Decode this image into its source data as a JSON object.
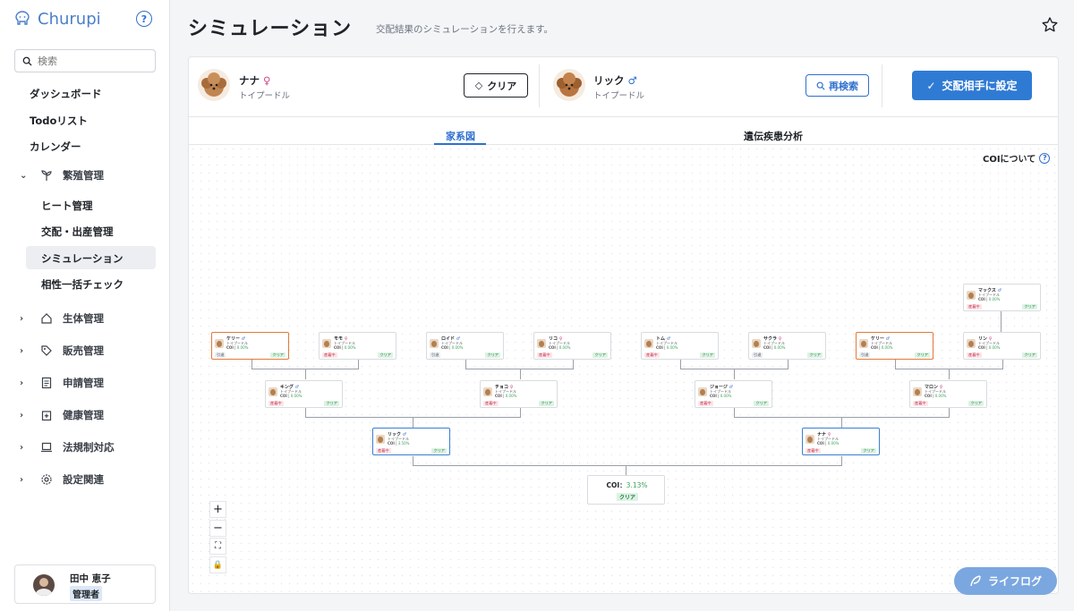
{
  "app": {
    "name": "Churupi",
    "help": "?"
  },
  "search": {
    "placeholder": "検索"
  },
  "nav": {
    "items": [
      "ダッシュボード",
      "Todoリスト",
      "カレンダー"
    ],
    "breeding": {
      "label": "繁殖管理",
      "sub": [
        "ヒート管理",
        "交配・出産管理",
        "シミュレーション",
        "相性一括チェック"
      ],
      "active_index": 2
    },
    "groups": [
      {
        "label": "生体管理",
        "icon": "house-icon"
      },
      {
        "label": "販売管理",
        "icon": "tag-icon"
      },
      {
        "label": "申請管理",
        "icon": "document-icon"
      },
      {
        "label": "健康管理",
        "icon": "medical-icon"
      },
      {
        "label": "法規制対応",
        "icon": "laptop-icon"
      },
      {
        "label": "設定関連",
        "icon": "gear-icon"
      }
    ]
  },
  "user": {
    "name": "田中 恵子",
    "role": "管理者"
  },
  "header": {
    "title": "シミュレーション",
    "subtitle": "交配結果のシミュレーションを行えます。"
  },
  "female": {
    "name": "ナナ",
    "sex_symbol": "♀",
    "breed": "トイプードル"
  },
  "male": {
    "name": "リック",
    "sex_symbol": "♂",
    "breed": "トイプードル"
  },
  "buttons": {
    "clear": "クリア",
    "research": "再検索",
    "set_partner": "交配相手に設定"
  },
  "tabs": {
    "pedigree": "家系図",
    "disease": "遺伝疾患分析"
  },
  "coi_about": "COIについて",
  "tree": {
    "coi_label": "COI",
    "clear_label": "クリア",
    "result": {
      "label": "COI：",
      "value": "3.13%",
      "badge": "クリア"
    },
    "nodes": [
      {
        "id": "max",
        "name": "マックス",
        "sex": "♂",
        "breed": "トイプードル",
        "coi": "0.00%",
        "status": "産着中",
        "status_type": "red"
      },
      {
        "id": "kerry1",
        "name": "ケリー",
        "sex": "♂",
        "breed": "トイプードル",
        "coi": "0.00%",
        "status": "引退",
        "status_type": "gray",
        "highlight": "orange"
      },
      {
        "id": "momo",
        "name": "モモ",
        "sex": "♀",
        "breed": "トイプードル",
        "coi": "0.00%",
        "status": "産着中",
        "status_type": "red"
      },
      {
        "id": "lloyd",
        "name": "ロイド",
        "sex": "♂",
        "breed": "トイプードル",
        "coi": "0.00%",
        "status": "引退",
        "status_type": "gray"
      },
      {
        "id": "riko",
        "name": "リコ",
        "sex": "♀",
        "breed": "トイプードル",
        "coi": "0.00%",
        "status": "産着中",
        "status_type": "red"
      },
      {
        "id": "tom",
        "name": "トム",
        "sex": "♂",
        "breed": "トイプードル",
        "coi": "0.00%",
        "status": "産着中",
        "status_type": "red"
      },
      {
        "id": "sakura",
        "name": "サクラ",
        "sex": "♀",
        "breed": "トイプードル",
        "coi": "0.00%",
        "status": "引退",
        "status_type": "gray"
      },
      {
        "id": "kerry2",
        "name": "ケリー",
        "sex": "♂",
        "breed": "トイプードル",
        "coi": "0.00%",
        "status": "引退",
        "status_type": "gray",
        "highlight": "orange"
      },
      {
        "id": "rin",
        "name": "リン",
        "sex": "♀",
        "breed": "トイプードル",
        "coi": "0.00%",
        "status": "産着中",
        "status_type": "red"
      },
      {
        "id": "king",
        "name": "キング",
        "sex": "♂",
        "breed": "トイプードル",
        "coi": "0.00%",
        "status": "産着中",
        "status_type": "red"
      },
      {
        "id": "choco",
        "name": "チョコ",
        "sex": "♀",
        "breed": "トイプードル",
        "coi": "0.00%",
        "status": "産着中",
        "status_type": "red"
      },
      {
        "id": "george",
        "name": "ジョージ",
        "sex": "♂",
        "breed": "トイプードル",
        "coi": "0.00%",
        "status": "産着中",
        "status_type": "red"
      },
      {
        "id": "maron",
        "name": "マロン",
        "sex": "♀",
        "breed": "トイプードル",
        "coi": "0.00%",
        "status": "産着中",
        "status_type": "red"
      },
      {
        "id": "rick",
        "name": "リック",
        "sex": "♂",
        "breed": "トイプードル",
        "coi": "3.50%",
        "status": "産着中",
        "status_type": "red",
        "highlight": "blue"
      },
      {
        "id": "nana",
        "name": "ナナ",
        "sex": "♀",
        "breed": "トイプードル",
        "coi": "0.00%",
        "status": "産着中",
        "status_type": "red",
        "highlight": "blue"
      }
    ]
  },
  "zoom": {
    "in": "+",
    "out": "−",
    "fit": "⛶",
    "lock": "🔒"
  },
  "lifelog": "ライフログ",
  "colors": {
    "primary": "#2f7bd3",
    "orange": "#e07b39",
    "female": "#d04a86",
    "male": "#2f6fd0"
  }
}
